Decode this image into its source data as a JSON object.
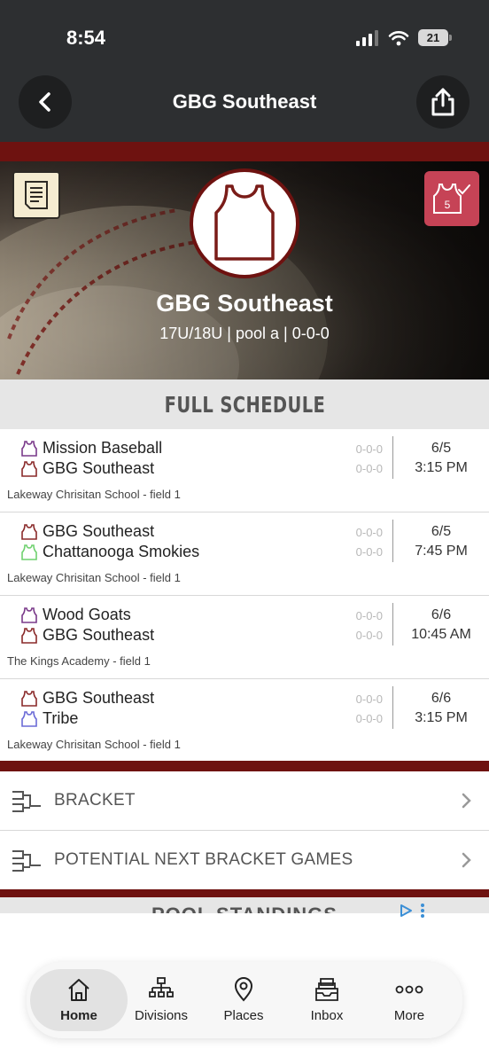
{
  "status": {
    "time": "8:54",
    "battery": "21"
  },
  "header": {
    "title": "GBG Southeast"
  },
  "hero": {
    "team_name": "GBG Southeast",
    "subtitle": "17U/18U | pool a | 0-0-0",
    "score_badge": "5"
  },
  "schedule": {
    "heading": "FULL SCHEDULE",
    "games": [
      {
        "team1": "Mission Baseball",
        "team1_color": "#7a3a8a",
        "team1_record": "0-0-0",
        "team2": "GBG Southeast",
        "team2_color": "#8a2a2a",
        "team2_record": "0-0-0",
        "date": "6/5",
        "time": "3:15 PM",
        "venue": "Lakeway Chrisitan School - field 1"
      },
      {
        "team1": "GBG Southeast",
        "team1_color": "#8a2a2a",
        "team1_record": "0-0-0",
        "team2": "Chattanooga Smokies",
        "team2_color": "#6fd16f",
        "team2_record": "0-0-0",
        "date": "6/5",
        "time": "7:45 PM",
        "venue": "Lakeway Chrisitan School - field 1"
      },
      {
        "team1": "Wood Goats",
        "team1_color": "#7a3a8a",
        "team1_record": "0-0-0",
        "team2": "GBG Southeast",
        "team2_color": "#8a2a2a",
        "team2_record": "0-0-0",
        "date": "6/6",
        "time": "10:45 AM",
        "venue": "The Kings Academy - field 1"
      },
      {
        "team1": "GBG Southeast",
        "team1_color": "#8a2a2a",
        "team1_record": "0-0-0",
        "team2": "Tribe",
        "team2_color": "#6a6ad6",
        "team2_record": "0-0-0",
        "date": "6/6",
        "time": "3:15 PM",
        "venue": "Lakeway Chrisitan School - field 1"
      }
    ]
  },
  "links": {
    "bracket": "BRACKET",
    "potential": "POTENTIAL NEXT BRACKET GAMES"
  },
  "pool_peek": "POOL STANDINGS",
  "tabs": {
    "home": "Home",
    "divisions": "Divisions",
    "places": "Places",
    "inbox": "Inbox",
    "more": "More"
  },
  "colors": {
    "maroon": "#6e1210",
    "header_bg": "#2d2f31",
    "badge": "#c64356"
  }
}
